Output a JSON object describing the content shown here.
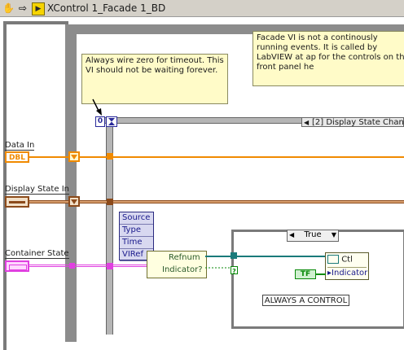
{
  "window": {
    "title": "XControl 1_Facade 1_BD",
    "toolbar_icons": [
      "hand-icon",
      "arrow-icon",
      "labview-icon"
    ]
  },
  "comments": {
    "timeout": "Always wire zero for timeout. This VI should not be waiting forever.",
    "facade": "Facade VI is not a continously running events.  It is called by LabVIEW at ap for the controls on the front panel he"
  },
  "frame": {
    "timeout_value": "0",
    "event_case_label": "[2] Display State Chan"
  },
  "terminals": {
    "data_in": {
      "label": "Data In",
      "type": "DBL"
    },
    "display_state_in": {
      "label": "Display State In"
    },
    "container_state": {
      "label": "Container State"
    }
  },
  "event_data": [
    "Source",
    "Type",
    "Time",
    "VIRef"
  ],
  "bundle_fields": [
    "Refnum",
    "Indicator?"
  ],
  "case_structure": {
    "selector_value": "True",
    "bool_constant": "TF",
    "property_node": {
      "class": "Ctl",
      "property": "Indicator"
    },
    "label": "ALWAYS A CONTROL"
  },
  "colors": {
    "dbl_orange": "#f08a00",
    "cluster_brown": "#8c4a1a",
    "cluster_pink": "#e040e0",
    "refnum_teal": "#1a7a7a",
    "bool_green": "#0a8a0a",
    "comment_bg": "#fffbc8"
  }
}
